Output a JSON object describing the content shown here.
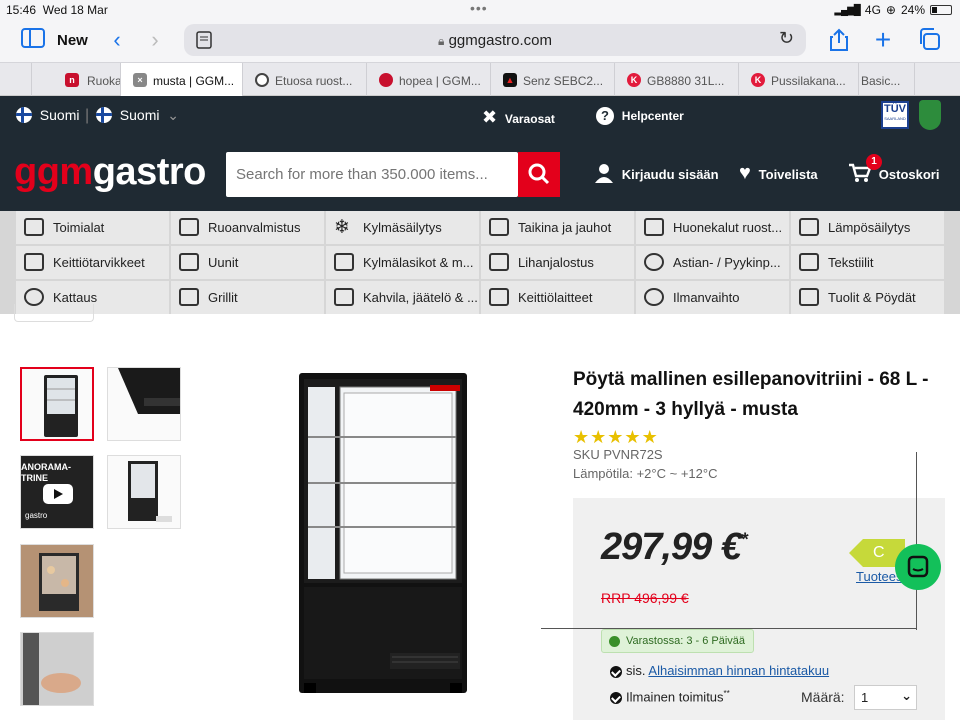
{
  "status": {
    "time": "15:46",
    "date": "Wed 18 Mar",
    "network": "4G",
    "battery": "24%"
  },
  "toolbar": {
    "new_label": "New",
    "url": "ggmgastro.com"
  },
  "tabs": [
    {
      "label": "Ruoka",
      "favicon_color": "#c8102e",
      "favicon_text": "n"
    },
    {
      "label": "musta | GGM...",
      "favicon_color": "#888888",
      "favicon_text": "×"
    },
    {
      "label": "Etuosa ruost...",
      "favicon_color": "#444444",
      "favicon_text": ""
    },
    {
      "label": "hopea | GGM...",
      "favicon_color": "#c8102e",
      "favicon_text": ""
    },
    {
      "label": "Senz SEBC2...",
      "favicon_color": "#d11",
      "favicon_text": ""
    },
    {
      "label": "GB8880 31L...",
      "favicon_color": "#e21b3c",
      "favicon_text": "K"
    },
    {
      "label": "Pussilakana...",
      "favicon_color": "#e21b3c",
      "favicon_text": "K"
    },
    {
      "label": "Basic...",
      "favicon_color": "#ccc",
      "favicon_text": ""
    }
  ],
  "header": {
    "lang1": "Suomi",
    "lang2": "Suomi",
    "spare_parts": "Varaosat",
    "helpcenter": "Helpcenter",
    "logo_ggm": "ggm",
    "logo_gastro": "gastro",
    "search_placeholder": "Search for more than 350.000 items...",
    "login": "Kirjaudu sisään",
    "wishlist": "Toivelista",
    "cart": "Ostoskori",
    "cart_count": "1",
    "tuv": "TÜV",
    "tuv_sub": "SAARLAND"
  },
  "categories": [
    "Toimialat",
    "Ruoanvalmistus",
    "Kylmäsäilytys",
    "Taikina ja jauhot",
    "Huonekalut ruost...",
    "Lämpösäilytys",
    "Keittiötarvikkeet",
    "Uunit",
    "Kylmälasikot & m...",
    "Lihanjalostus",
    "Astian- / Pyykinp...",
    "Tekstiilit",
    "Kattaus",
    "Grillit",
    "Kahvila, jäätelö & ...",
    "Keittiölaitteet",
    "Ilmanvaihto",
    "Tuolit & Pöydät"
  ],
  "gallery": {
    "video_label": "ANORAMA-\nTRINE",
    "brand_text": "gastro"
  },
  "product": {
    "title": "Pöytä mallinen esillepanovitriini - 68 L - 420mm - 3 hyllyä - musta",
    "rating_stars": 5,
    "sku": "SKU PVNR72S",
    "temperature": "Lämpötila: +2°C ~ +12°C",
    "price": "297,99 €",
    "price_mark": "*",
    "rrp": "RRP 496,99 €",
    "energy_class": "C",
    "energy_link": "Tuotees",
    "stock": "Varastossa: 3 - 6 Päivää",
    "incl_prefix": "sis.",
    "price_guarantee": "Alhaisimman hinnan hintatakuu",
    "free_shipping": "Ilmainen toimitus",
    "free_shipping_mark": "**",
    "qty_label": "Määrä:",
    "qty_value": "1"
  },
  "colors": {
    "brand_red": "#e3001b",
    "header_bg": "#1f2a33",
    "chat_green": "#13c05a",
    "safari_blue": "#1a73e8"
  }
}
